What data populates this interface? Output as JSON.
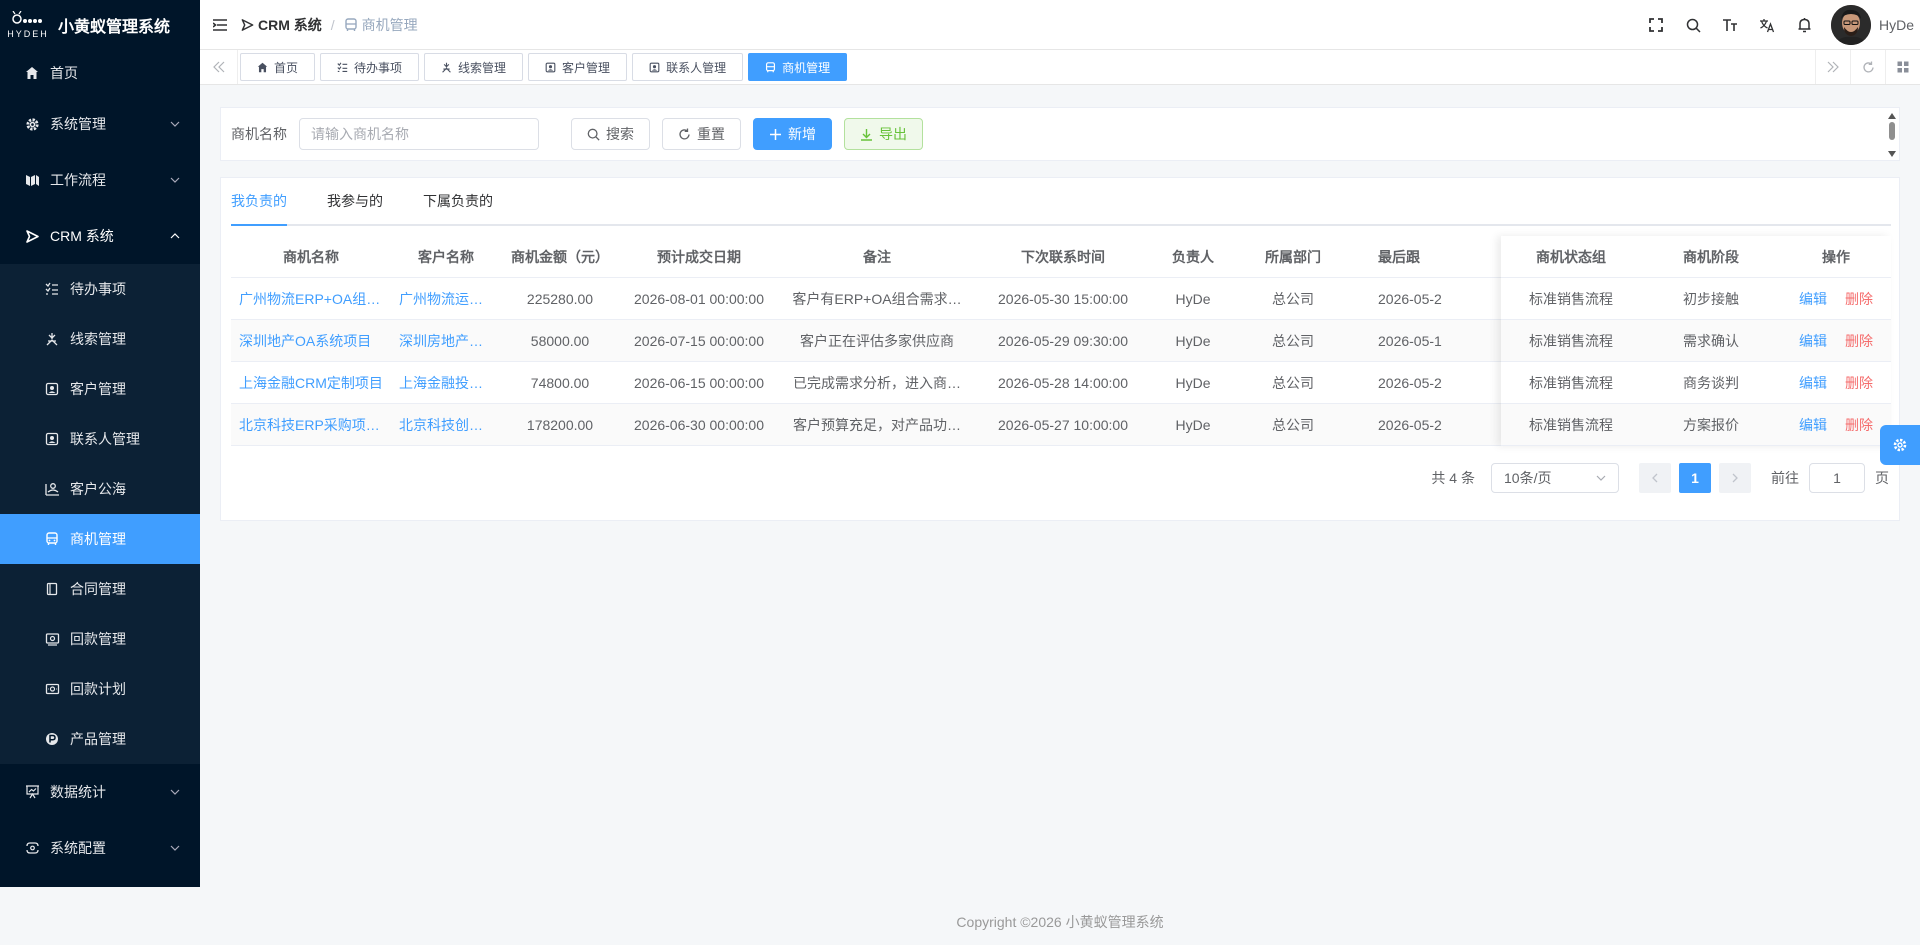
{
  "app": {
    "title": "小黄蚁管理系统",
    "logo_text": "HYDEH"
  },
  "sidebar": {
    "items": [
      {
        "label": "首页",
        "icon": "home-icon"
      },
      {
        "label": "系统管理",
        "icon": "gear-icon"
      },
      {
        "label": "工作流程",
        "icon": "workflow-icon"
      },
      {
        "label": "CRM 系统",
        "icon": "crm-icon"
      }
    ],
    "crm_sub": [
      {
        "label": "待办事项",
        "icon": "todo-icon"
      },
      {
        "label": "线索管理",
        "icon": "clue-icon"
      },
      {
        "label": "客户管理",
        "icon": "customer-icon"
      },
      {
        "label": "联系人管理",
        "icon": "contact-icon"
      },
      {
        "label": "客户公海",
        "icon": "sea-icon"
      },
      {
        "label": "商机管理",
        "icon": "bus-icon"
      },
      {
        "label": "合同管理",
        "icon": "contract-icon"
      },
      {
        "label": "回款管理",
        "icon": "receivable-icon"
      },
      {
        "label": "回款计划",
        "icon": "plan-icon"
      },
      {
        "label": "产品管理",
        "icon": "product-icon"
      }
    ],
    "bottom": [
      {
        "label": "数据统计",
        "icon": "chart-icon"
      },
      {
        "label": "系统配置",
        "icon": "config-icon"
      }
    ]
  },
  "navbar": {
    "breadcrumb": [
      "CRM 系统",
      "商机管理"
    ],
    "username": "HyDe"
  },
  "tags": [
    {
      "label": "首页"
    },
    {
      "label": "待办事项"
    },
    {
      "label": "线索管理"
    },
    {
      "label": "客户管理"
    },
    {
      "label": "联系人管理"
    },
    {
      "label": "商机管理"
    }
  ],
  "search": {
    "label": "商机名称",
    "placeholder": "请输入商机名称",
    "search_btn": "搜索",
    "reset_btn": "重置",
    "add_btn": "新增",
    "export_btn": "导出"
  },
  "tabs": [
    "我负责的",
    "我参与的",
    "下属负责的"
  ],
  "table": {
    "columns": [
      "商机名称",
      "客户名称",
      "商机金额（元）",
      "预计成交日期",
      "备注",
      "下次联系时间",
      "负责人",
      "所属部门",
      "最后跟进时间",
      "商机状态组",
      "商机阶段",
      "操作"
    ],
    "visible_last_follow_header": "最后跟",
    "rows": [
      [
        "广州物流ERP+OA组合项目",
        "广州物流运输有限公司",
        "225280.00",
        "2026-08-01 00:00:00",
        "客户有ERP+OA组合需求…",
        "2026-05-30 15:00:00",
        "HyDe",
        "总公司",
        "2026-05-2",
        "标准销售流程",
        "初步接触"
      ],
      [
        "深圳地产OA系统项目",
        "深圳房地产开发有限公司",
        "58000.00",
        "2026-07-15 00:00:00",
        "客户正在评估多家供应商",
        "2026-05-29 09:30:00",
        "HyDe",
        "总公司",
        "2026-05-1",
        "标准销售流程",
        "需求确认"
      ],
      [
        "上海金融CRM定制项目",
        "上海金融投资集团",
        "74800.00",
        "2026-06-15 00:00:00",
        "已完成需求分析，进入商…",
        "2026-05-28 14:00:00",
        "HyDe",
        "总公司",
        "2026-05-2",
        "标准销售流程",
        "商务谈判"
      ],
      [
        "北京科技ERP采购项目…",
        "北京科技创新有限公司",
        "178200.00",
        "2026-06-30 00:00:00",
        "客户预算充足，对产品功…",
        "2026-05-27 10:00:00",
        "HyDe",
        "总公司",
        "2026-05-2",
        "标准销售流程",
        "方案报价"
      ]
    ],
    "edit_label": "编辑",
    "delete_label": "删除"
  },
  "pagination": {
    "total": "共 4 条",
    "page_size": "10条/页",
    "current": "1",
    "goto_label": "前往",
    "goto_value": "1",
    "page_suffix": "页"
  },
  "footer": "Copyright ©2026 小黄蚁管理系统",
  "colors": {
    "sidebar_bg": "#001529",
    "primary": "#409eff",
    "danger": "#f56c6c",
    "success": "#67c23a"
  }
}
